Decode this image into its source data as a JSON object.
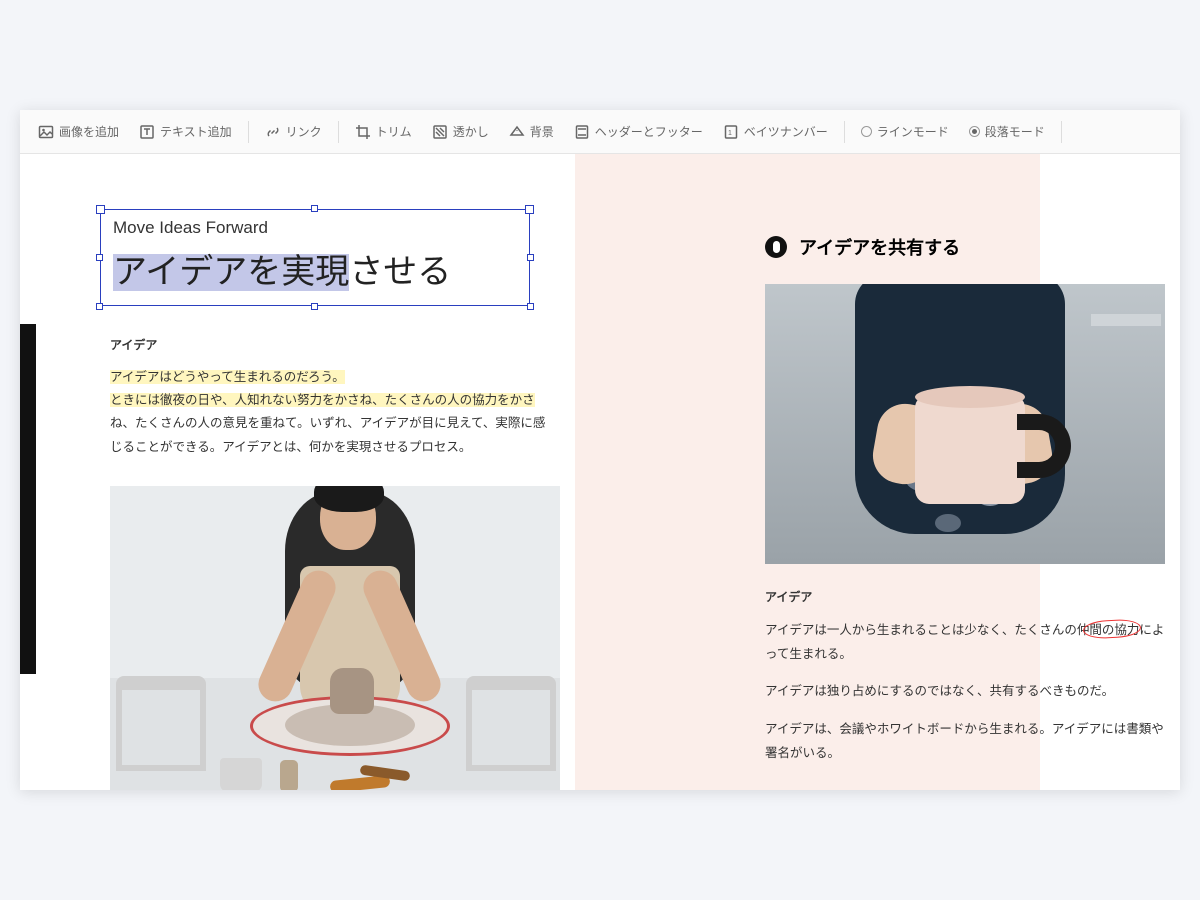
{
  "toolbar": {
    "add_image": "画像を追加",
    "add_text": "テキスト追加",
    "link": "リンク",
    "trim": "トリム",
    "watermark": "透かし",
    "background": "背景",
    "header_footer": "ヘッダーとフッター",
    "bates": "ベイツナンバー",
    "line_mode": "ラインモード",
    "paragraph_mode": "段落モード"
  },
  "doc": {
    "eng_subtitle": "Move Ideas Forward",
    "jp_title_selected": "アイデアを実現",
    "jp_title_rest": "させる",
    "left_section_label": "アイデア",
    "left_hl_line1": "アイデアはどうやって生まれるのだろう。",
    "left_hl_line2_a": "ときには徹夜の日や、人知れない努力をかさね、たくさんの人の協力をかさ",
    "left_rest": "ね、たくさんの人の意見を重ねて。いずれ、アイデアが目に見えて、実際に感じることができる。アイデアとは、何かを実現させるプロセス。",
    "right_heading": "アイデアを共有する",
    "right_section_label": "アイデア",
    "right_p1_a": "アイデアは一人から生まれることは少なく、たくさんの",
    "right_p1_annot": "仲間の協力",
    "right_p1_b": "によって生まれる。",
    "right_p2": "アイデアは独り占めにするのではなく、共有するべきものだ。",
    "right_p3": "アイデアは、会議やホワイトボードから生まれる。アイデアには書類や署名がいる。"
  }
}
